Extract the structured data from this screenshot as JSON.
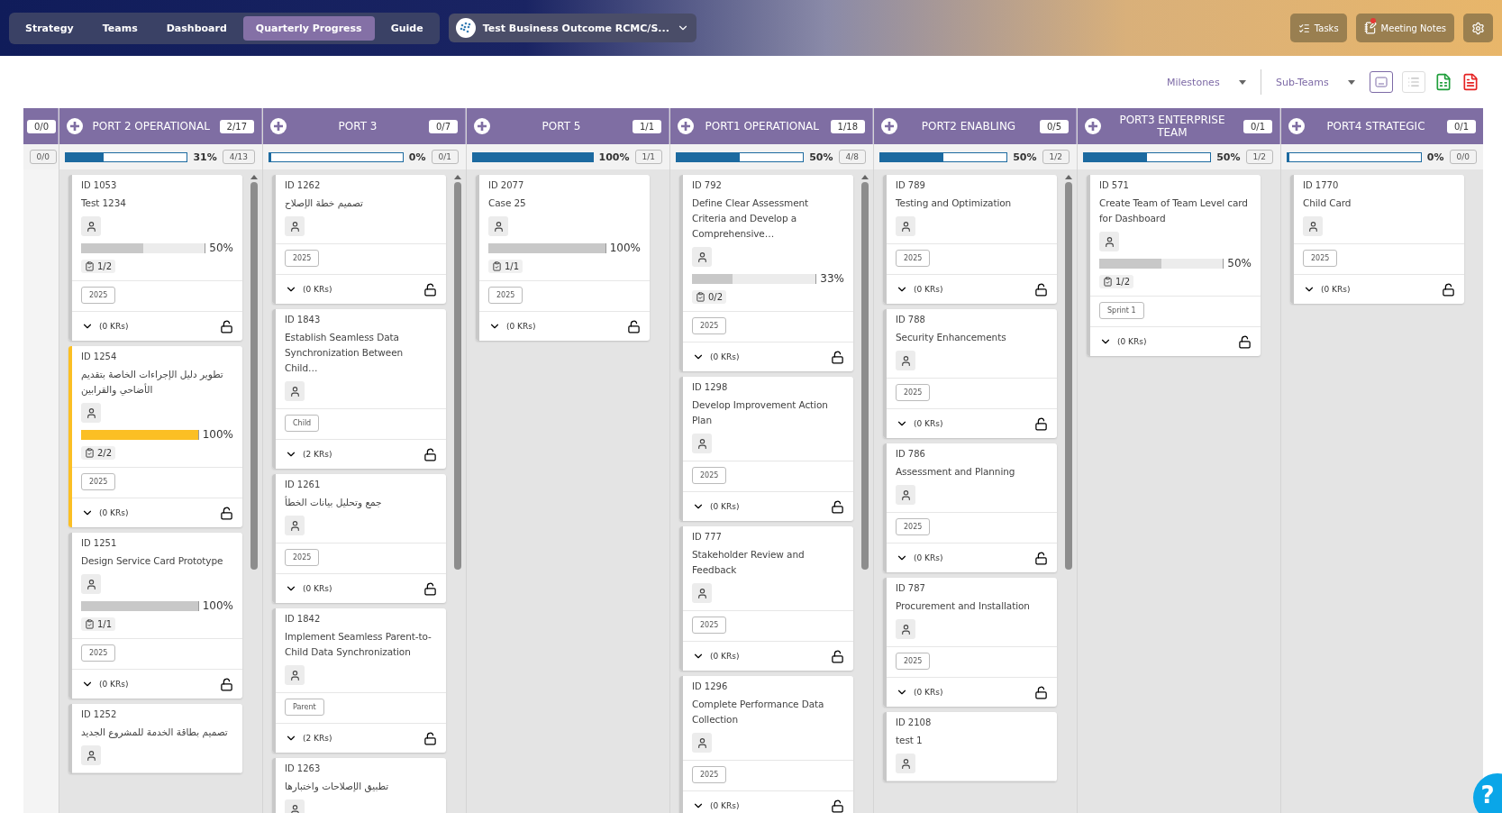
{
  "nav": {
    "tabs": [
      {
        "label": "Strategy",
        "selected": false
      },
      {
        "label": "Teams",
        "selected": false
      },
      {
        "label": "Dashboard",
        "selected": false
      },
      {
        "label": "Quarterly Progress",
        "selected": true
      },
      {
        "label": "Guide",
        "selected": false
      }
    ],
    "outcome_select": "Test Business Outcome RCMC/S...",
    "actions": [
      {
        "kind": "tasks",
        "label": "Tasks",
        "unread": false
      },
      {
        "kind": "notes",
        "label": "Meeting Notes",
        "unread": true
      },
      {
        "kind": "settings",
        "unread": false
      }
    ]
  },
  "toolbar": {
    "filters": [
      "Milestones",
      "Sub-Teams"
    ],
    "views": [
      {
        "kind": "cards",
        "selected": true
      },
      {
        "kind": "list",
        "selected": false
      }
    ]
  },
  "partial_column": {
    "count": "0/0",
    "fraction": "0/0"
  },
  "columns": [
    {
      "name": "PORT 2 OPERATIONAL",
      "count": "2/17",
      "level": 0.31,
      "percent": "31%",
      "fraction": "4/13",
      "cards": [
        {
          "id": "ID 1053",
          "title": "Test 1234",
          "progress": {
            "level": 0.5,
            "label": "50%"
          },
          "checklist": "1/2",
          "tag": "2025",
          "krs": "(0 KRs)",
          "color": "#c8c8c8"
        },
        {
          "id": "ID 1254",
          "title": "تطوير دليل الإجراءات الخاصة بتقديم الأضاحي والقرابين",
          "progress": {
            "level": 1,
            "label": "100%"
          },
          "checklist": "2/2",
          "tag": "2025",
          "krs": "(0 KRs)",
          "color": "#fbbf24"
        },
        {
          "id": "ID 1251",
          "title": "Design Service Card Prototype",
          "progress": {
            "level": 1,
            "label": "100%"
          },
          "checklist": "1/1",
          "tag": "2025",
          "krs": "(0 KRs)",
          "color": "#c8c8c8"
        },
        {
          "id": "ID 1252",
          "title": "تصميم بطاقة الخدمة للمشروع الجديد",
          "color": "#c8c8c8"
        }
      ]
    },
    {
      "name": "PORT 3",
      "count": "0/7",
      "level": 0,
      "percent": "0%",
      "fraction": "0/1",
      "cards": [
        {
          "id": "ID 1262",
          "title": "تصميم خطة الإصلاح",
          "tag": "2025",
          "krs": "(0 KRs)",
          "color": "#c8c8c8"
        },
        {
          "id": "ID 1843",
          "title": "Establish Seamless Data Synchronization Between Child…",
          "tag": "Child",
          "krs": "(2 KRs)",
          "color": "#c8c8c8"
        },
        {
          "id": "ID 1261",
          "title": "جمع وتحليل بيانات الخطأ",
          "tag": "2025",
          "krs": "(0 KRs)",
          "color": "#c8c8c8"
        },
        {
          "id": "ID 1842",
          "title": "Implement Seamless Parent-to-Child Data Synchronization",
          "tag": "Parent",
          "krs": "(2 KRs)",
          "color": "#c8c8c8"
        },
        {
          "id": "ID 1263",
          "title": "تطبيق الإصلاحات واختبارها",
          "color": "#c8c8c8"
        }
      ]
    },
    {
      "name": "PORT 5",
      "count": "1/1",
      "level": 1,
      "percent": "100%",
      "fraction": "1/1",
      "cards": [
        {
          "id": "ID 2077",
          "title": "Case 25",
          "progress": {
            "level": 1,
            "label": "100%"
          },
          "checklist": "1/1",
          "tag": "2025",
          "krs": "(0 KRs)",
          "color": "#c8c8c8"
        }
      ]
    },
    {
      "name": "PORT1 OPERATIONAL",
      "count": "1/18",
      "level": 0.5,
      "percent": "50%",
      "fraction": "4/8",
      "cards": [
        {
          "id": "ID 792",
          "title": "Define Clear Assessment Criteria and Develop a Comprehensive…",
          "progress": {
            "level": 0.33,
            "label": "33%"
          },
          "checklist": "0/2",
          "tag": "2025",
          "krs": "(0 KRs)",
          "color": "#c8c8c8"
        },
        {
          "id": "ID 1298",
          "title": "Develop Improvement Action Plan",
          "tag": "2025",
          "krs": "(0 KRs)",
          "color": "#c8c8c8"
        },
        {
          "id": "ID 777",
          "title": "Stakeholder Review and Feedback",
          "tag": "2025",
          "krs": "(0 KRs)",
          "color": "#c8c8c8"
        },
        {
          "id": "ID 1296",
          "title": "Complete Performance Data Collection",
          "tag": "2025",
          "krs": "(0 KRs)",
          "color": "#c8c8c8"
        }
      ]
    },
    {
      "name": "PORT2 ENABLING",
      "count": "0/5",
      "level": 0.5,
      "percent": "50%",
      "fraction": "1/2",
      "cards": [
        {
          "id": "ID 789",
          "title": "Testing and Optimization",
          "tag": "2025",
          "krs": "(0 KRs)",
          "color": "#c8c8c8"
        },
        {
          "id": "ID 788",
          "title": "Security Enhancements",
          "tag": "2025",
          "krs": "(0 KRs)",
          "color": "#c8c8c8"
        },
        {
          "id": "ID 786",
          "title": "Assessment and Planning",
          "tag": "2025",
          "krs": "(0 KRs)",
          "color": "#c8c8c8"
        },
        {
          "id": "ID 787",
          "title": "Procurement and Installation",
          "tag": "2025",
          "krs": "(0 KRs)",
          "color": "#c8c8c8"
        },
        {
          "id": "ID 2108",
          "title": "test 1",
          "color": "#c8c8c8"
        }
      ]
    },
    {
      "name": "PORT3 ENTERPRISE TEAM",
      "count": "0/1",
      "level": 0.5,
      "percent": "50%",
      "fraction": "1/2",
      "cards": [
        {
          "id": "ID 571",
          "title": "Create Team of Team Level card for Dashboard",
          "progress": {
            "level": 0.5,
            "label": "50%"
          },
          "checklist": "1/2",
          "tag": "Sprint 1",
          "krs": "(0 KRs)",
          "color": "#c8c8c8"
        }
      ]
    },
    {
      "name": "PORT4 STRATEGIC",
      "count": "0/1",
      "level": 0,
      "percent": "0%",
      "fraction": "0/0",
      "cards": [
        {
          "id": "ID 1770",
          "title": "Child Card",
          "tag": "2025",
          "krs": "(0 KRs)",
          "color": "#c8c8c8"
        }
      ]
    }
  ],
  "help_button": "?"
}
